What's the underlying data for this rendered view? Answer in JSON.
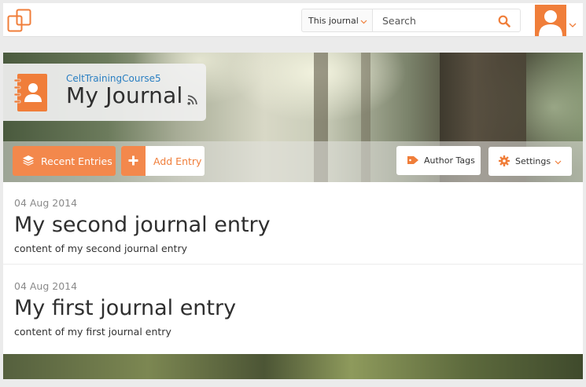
{
  "header": {
    "logo_icon": "windows-icon",
    "search_scope": "This journal",
    "search_placeholder": "Search",
    "search_icon": "search-icon",
    "avatar_icon": "user-icon"
  },
  "journal": {
    "site_name": "CeltTrainingCourse5",
    "title": "My Journal",
    "icon": "book-contact-icon",
    "feed_icon": "rss-icon"
  },
  "toolbar": {
    "recent_label": "Recent Entries",
    "add_label": "Add Entry",
    "tags_label": "Author Tags",
    "settings_label": "Settings"
  },
  "entries": [
    {
      "date": "04 Aug 2014",
      "title": "My second journal entry",
      "content": "content of my second journal entry"
    },
    {
      "date": "04 Aug 2014",
      "title": "My first journal entry",
      "content": "content of my first journal entry"
    }
  ],
  "colors": {
    "accent": "#f3884c",
    "link": "#2a7fc2"
  }
}
